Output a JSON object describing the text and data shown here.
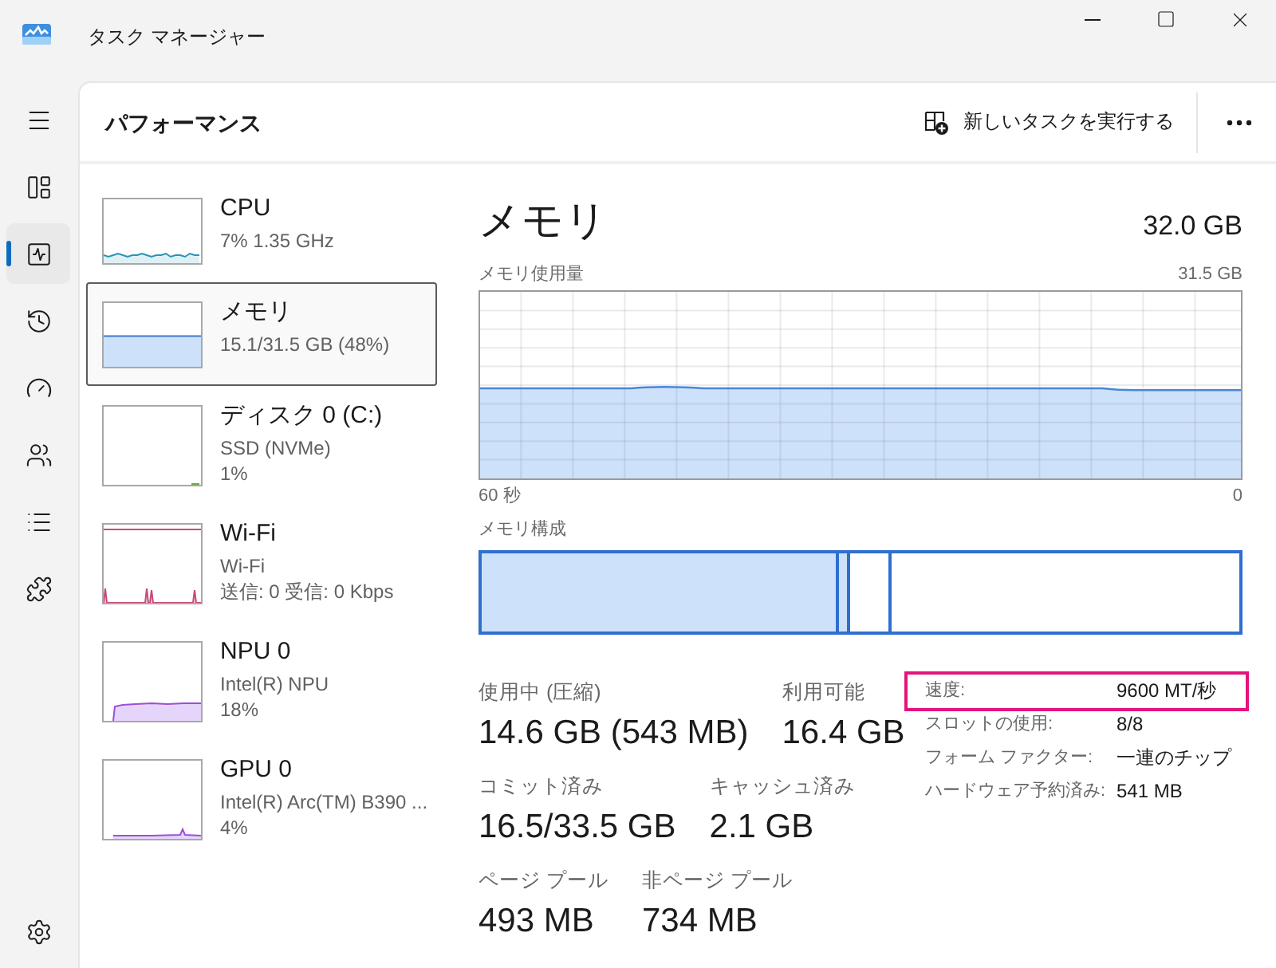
{
  "window": {
    "title": "タスク マネージャー"
  },
  "nav": {
    "items": [
      {
        "kind": "processes",
        "selected": false
      },
      {
        "kind": "performance",
        "selected": true
      },
      {
        "kind": "history",
        "selected": false
      },
      {
        "kind": "startup",
        "selected": false
      },
      {
        "kind": "users",
        "selected": false
      },
      {
        "kind": "details",
        "selected": false
      },
      {
        "kind": "services",
        "selected": false
      }
    ]
  },
  "page": {
    "title": "パフォーマンス",
    "run_task_button": "新しいタスクを実行する"
  },
  "resources": [
    {
      "kind": "cpu",
      "name": "CPU",
      "details": [
        "7% 1.35 GHz"
      ],
      "selected": false
    },
    {
      "kind": "memory",
      "name": "メモリ",
      "details": [
        "15.1/31.5 GB (48%)"
      ],
      "selected": true
    },
    {
      "kind": "disk",
      "name": "ディスク 0 (C:)",
      "details": [
        "SSD (NVMe)",
        "1%"
      ],
      "selected": false
    },
    {
      "kind": "network",
      "name": "Wi-Fi",
      "details": [
        "Wi-Fi",
        "送信: 0 受信: 0 Kbps"
      ],
      "selected": false
    },
    {
      "kind": "npu",
      "name": "NPU 0",
      "details": [
        "Intel(R) NPU",
        "18%"
      ],
      "selected": false
    },
    {
      "kind": "gpu",
      "name": "GPU 0",
      "details": [
        "Intel(R) Arc(TM) B390 ...",
        "4%"
      ],
      "selected": false
    }
  ],
  "memory": {
    "title": "メモリ",
    "total": "32.0 GB",
    "usage_graph": {
      "label": "メモリ使用量",
      "max_label": "31.5 GB",
      "start_label": "60 秒",
      "end_label": "0"
    },
    "composition": {
      "label": "メモリ構成"
    },
    "stat_rows": [
      {
        "items": [
          {
            "label": "使用中 (圧縮)",
            "value": "14.6 GB (543 MB)"
          },
          {
            "label": "利用可能",
            "value": "16.4 GB"
          }
        ]
      },
      {
        "items": [
          {
            "label": "コミット済み",
            "value": "16.5/33.5 GB"
          },
          {
            "label": "キャッシュ済み",
            "value": "2.1 GB"
          }
        ]
      },
      {
        "items": [
          {
            "label": "ページ プール",
            "value": "493 MB"
          },
          {
            "label": "非ページ プール",
            "value": "734 MB"
          }
        ]
      }
    ],
    "specs": [
      {
        "label": "速度:",
        "value": "9600 MT/秒",
        "highlighted": true
      },
      {
        "label": "スロットの使用:",
        "value": "8/8",
        "highlighted": false
      },
      {
        "label": "フォーム ファクター:",
        "value": "一連のチップ",
        "highlighted": false
      },
      {
        "label": "ハードウェア予約済み:",
        "value": "541 MB",
        "highlighted": false
      }
    ]
  }
}
